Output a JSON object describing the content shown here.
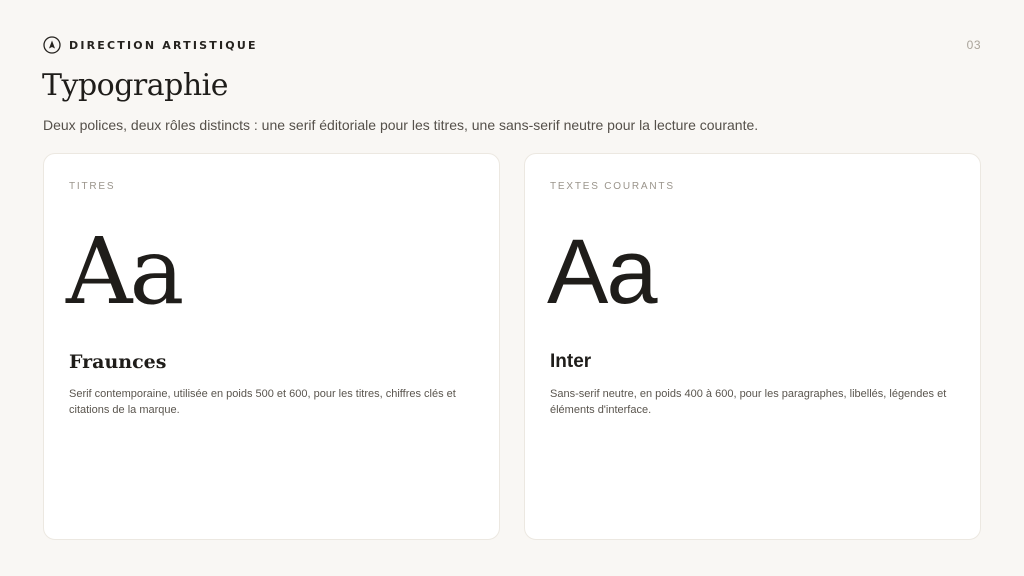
{
  "header": {
    "brand_label": "DIRECTION ARTISTIQUE",
    "brand_icon": "compass-icon",
    "page_number": "03"
  },
  "title": "Typographie",
  "subtitle": "Deux polices, deux rôles distincts : une serif éditoriale pour les titres, une sans-serif neutre pour la lecture courante.",
  "cards": [
    {
      "label": "TITRES",
      "specimen": "Aa",
      "font_name": "Fraunces",
      "description": "Serif contemporaine, utilisée en poids 500 et 600, pour les titres, chiffres clés et citations de la marque."
    },
    {
      "label": "TEXTES COURANTS",
      "specimen": "Aa",
      "font_name": "Inter",
      "description": "Sans-serif neutre, en poids 400 à 600, pour les paragraphes, libellés, légendes et éléments d'interface."
    }
  ],
  "colors": {
    "background": "#f9f7f4",
    "card": "#ffffff",
    "ink": "#1f1d1a",
    "muted": "#9a948b"
  }
}
